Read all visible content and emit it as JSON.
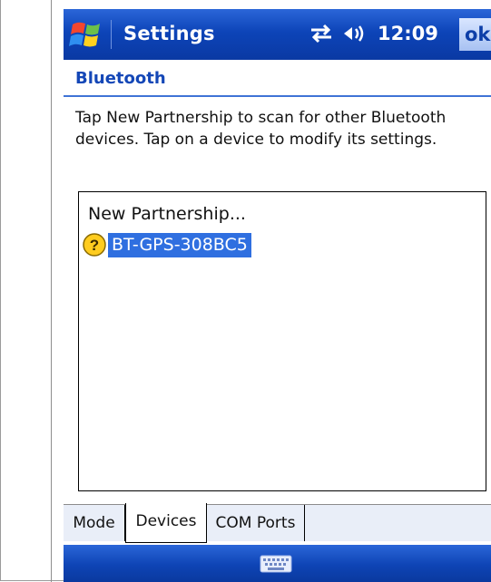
{
  "title_bar": {
    "app_title": "Settings",
    "clock": "12:09",
    "ok_label": "ok",
    "icons": [
      "windows-start-icon",
      "connectivity-icon",
      "volume-icon"
    ]
  },
  "page": {
    "title": "Bluetooth",
    "instructions": "Tap New Partnership to scan for other Bluetooth devices. Tap on a device to modify its settings."
  },
  "device_list": {
    "items": [
      {
        "label": "New Partnership...",
        "selected": false
      },
      {
        "label": "BT-GPS-308BC5",
        "selected": true,
        "icon": "unknown-device-icon"
      }
    ]
  },
  "tabs": [
    {
      "label": "Mode",
      "active": false
    },
    {
      "label": "Devices",
      "active": true
    },
    {
      "label": "COM Ports",
      "active": false
    }
  ],
  "softkey": {
    "icon": "keyboard-icon"
  },
  "colors": {
    "title_bar": "#0d44b8",
    "accent": "#1447b7",
    "selection": "#2f6fe0"
  }
}
